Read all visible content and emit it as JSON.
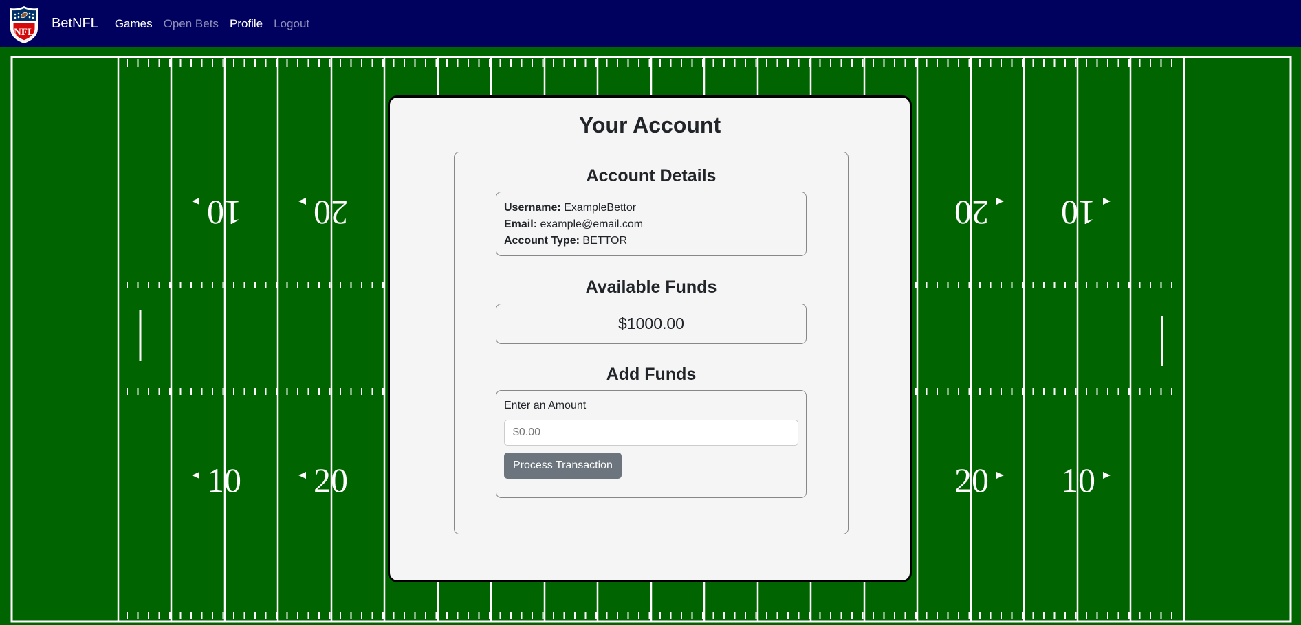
{
  "nav": {
    "brand": "BetNFL",
    "logo_text": "NFL",
    "links": [
      {
        "label": "Games",
        "state": "active"
      },
      {
        "label": "Open Bets",
        "state": "muted"
      },
      {
        "label": "Profile",
        "state": "active"
      },
      {
        "label": "Logout",
        "state": "muted"
      }
    ]
  },
  "field": {
    "numbers_top": [
      "10",
      "20",
      "20",
      "10"
    ],
    "numbers_bottom": [
      "10",
      "20",
      "20",
      "10"
    ]
  },
  "account": {
    "title": "Your Account",
    "details_title": "Account Details",
    "details": [
      {
        "label": "Username:",
        "value": "ExampleBettor"
      },
      {
        "label": "Email:",
        "value": "example@email.com"
      },
      {
        "label": "Account Type:",
        "value": "BETTOR"
      }
    ],
    "funds_title": "Available Funds",
    "funds_value": "$1000.00",
    "add_title": "Add Funds",
    "amount_label": "Enter an Amount",
    "amount_placeholder": "$0.00",
    "process_label": "Process Transaction"
  },
  "colors": {
    "navbar": "#00005f",
    "field": "#006400",
    "card": "#f5f5f5",
    "button": "#6c757d"
  }
}
